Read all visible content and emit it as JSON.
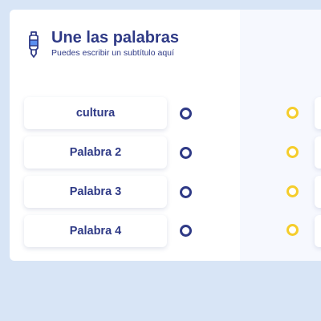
{
  "header": {
    "title": "Une las palabras",
    "subtitle": "Puedes escribir un subtítulo aquí",
    "icon": "marker-icon"
  },
  "left_words": [
    {
      "label": "cultura"
    },
    {
      "label": "Palabra 2"
    },
    {
      "label": "Palabra 3"
    },
    {
      "label": "Palabra 4"
    }
  ],
  "colors": {
    "background": "#d8e5f6",
    "card": "#ffffff",
    "right_pane": "#f6f8fe",
    "text": "#2f3a86",
    "left_dot": "#2f3a86",
    "right_dot": "#f5cd2c"
  }
}
